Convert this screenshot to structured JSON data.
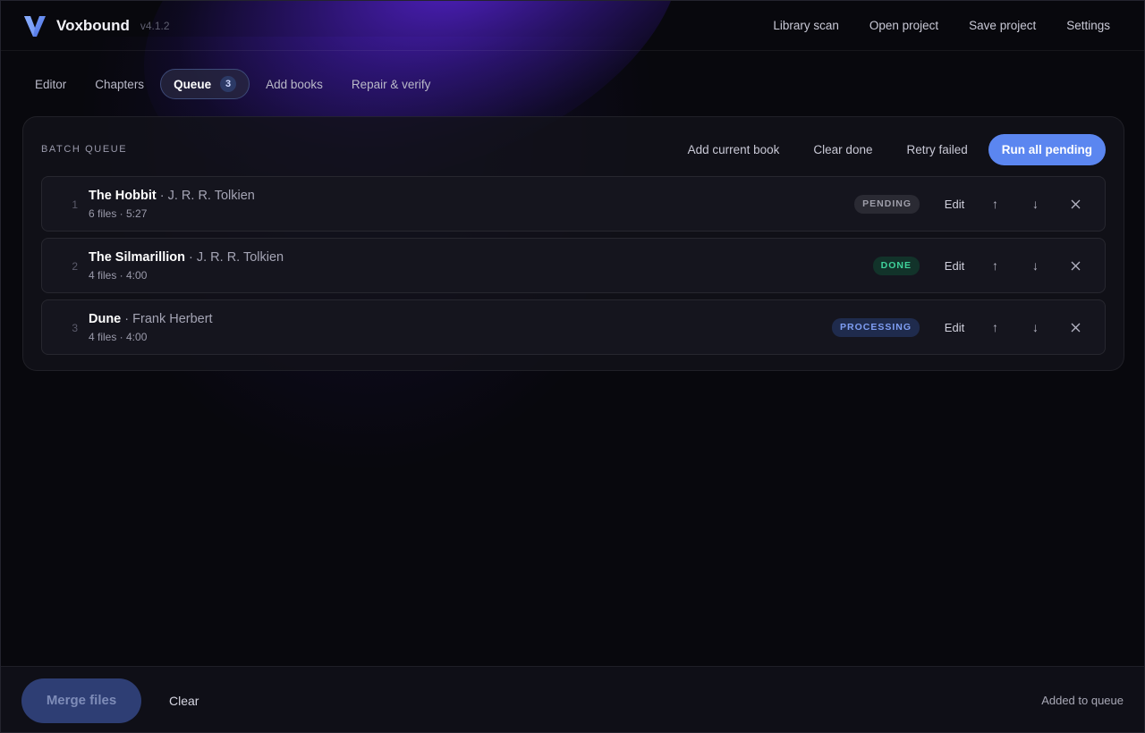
{
  "app": {
    "name": "Voxbound",
    "version": "v4.1.2",
    "logo_icon": "v-logo-icon",
    "accent_color": "#5b86f0"
  },
  "header": {
    "menu": [
      {
        "label": "Library scan"
      },
      {
        "label": "Open project"
      },
      {
        "label": "Save project"
      },
      {
        "label": "Settings"
      }
    ]
  },
  "tabs": [
    {
      "label": "Editor"
    },
    {
      "label": "Chapters"
    },
    {
      "label": "Queue",
      "badge": "3",
      "active": true
    },
    {
      "label": "Add books"
    },
    {
      "label": "Repair & verify"
    }
  ],
  "queue": {
    "title": "BATCH QUEUE",
    "actions": {
      "add_current": "Add current book",
      "clear_done": "Clear done",
      "retry_failed": "Retry failed",
      "run_all": "Run all pending"
    },
    "rows": [
      {
        "index": "1",
        "title": "The Hobbit",
        "sep": " · ",
        "author": "J. R. R. Tolkien",
        "meta": "6 files · 5:27",
        "status": "PENDING",
        "status_color": "#9e9eaa",
        "edit": "Edit"
      },
      {
        "index": "2",
        "title": "The Silmarillion",
        "sep": " · ",
        "author": "J. R. R. Tolkien",
        "meta": "4 files · 4:00",
        "status": "DONE",
        "status_color": "#3fd39b",
        "edit": "Edit"
      },
      {
        "index": "3",
        "title": "Dune",
        "sep": " · ",
        "author": "Frank Herbert",
        "meta": "4 files · 4:00",
        "status": "PROCESSING",
        "status_color": "#7f9ef4",
        "edit": "Edit"
      }
    ],
    "row_icons": {
      "up": "arrow-up-icon",
      "down": "arrow-down-icon",
      "remove": "close-icon"
    }
  },
  "footer": {
    "merge_label": "Merge files",
    "clear_label": "Clear",
    "status_text": "Added to queue"
  }
}
